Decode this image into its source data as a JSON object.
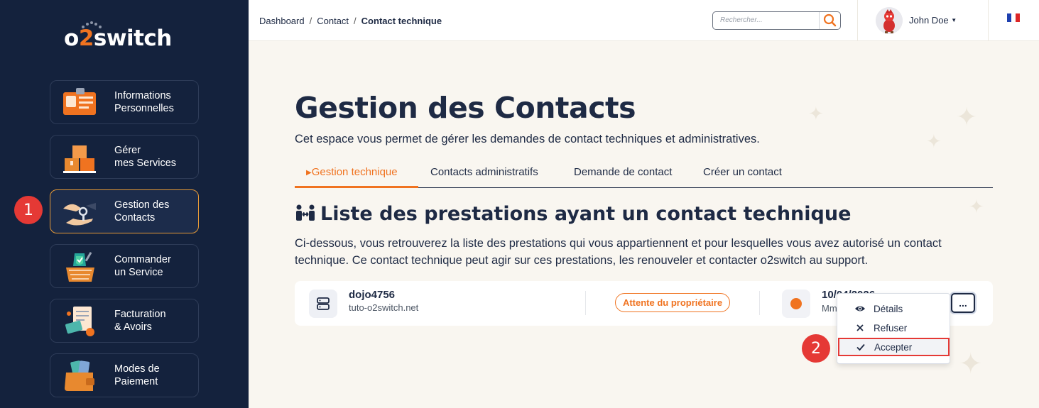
{
  "brand": {
    "logo_prefix": "o",
    "logo_accent": "2",
    "logo_suffix": "switch"
  },
  "sidebar": {
    "items": [
      {
        "label_line1": "Informations",
        "label_line2": "Personnelles",
        "icon": "id-card-icon"
      },
      {
        "label_line1": "Gérer",
        "label_line2": "mes Services",
        "icon": "boxes-icon"
      },
      {
        "label_line1": "Gestion des",
        "label_line2": "Contacts",
        "icon": "handshake-key-icon"
      },
      {
        "label_line1": "Commander",
        "label_line2": "un Service",
        "icon": "shopping-basket-icon"
      },
      {
        "label_line1": "Facturation",
        "label_line2": "& Avoirs",
        "icon": "invoice-icon"
      },
      {
        "label_line1": "Modes de",
        "label_line2": "Paiement",
        "icon": "wallet-icon"
      }
    ],
    "active_index": 2
  },
  "annotations": {
    "step1": "1",
    "step2": "2"
  },
  "topbar": {
    "breadcrumb": [
      "Dashboard",
      "Contact",
      "Contact technique"
    ],
    "breadcrumb_sep": "/",
    "search_placeholder": "Rechercher...",
    "user_name": "John Doe",
    "language": "FR"
  },
  "main": {
    "title": "Gestion des Contacts",
    "subtitle": "Cet espace vous permet de gérer les demandes de contact techniques et administratives.",
    "tabs": [
      {
        "label": "Gestion technique",
        "active": true
      },
      {
        "label": "Contacts administratifs",
        "active": false
      },
      {
        "label": "Demande de contact",
        "active": false
      },
      {
        "label": "Créer un contact",
        "active": false
      }
    ],
    "section_title": "Liste des prestations ayant un contact technique",
    "section_desc": "Ci-dessous, vous retrouverez la liste des prestations qui vous appartiennent et pour lesquelles vous avez autorisé un contact technique. Ce contact technique peut agir sur ces prestations, les renouveler et contacter o2switch au support.",
    "row": {
      "name": "dojo4756",
      "url": "tuto-o2switch.net",
      "status": "Attente du propriétaire",
      "date": "10/04/2026",
      "date_sub": "Mm",
      "more_label": "..."
    },
    "dropdown": [
      {
        "label": "Détails",
        "icon": "eye-icon"
      },
      {
        "label": "Refuser",
        "icon": "x-icon"
      },
      {
        "label": "Accepter",
        "icon": "check-icon"
      }
    ]
  },
  "colors": {
    "sidebar_bg": "#14223d",
    "accent": "#f07320",
    "text": "#1e2a44",
    "page_bg": "#f9f6f0",
    "annotation": "#e53935"
  }
}
